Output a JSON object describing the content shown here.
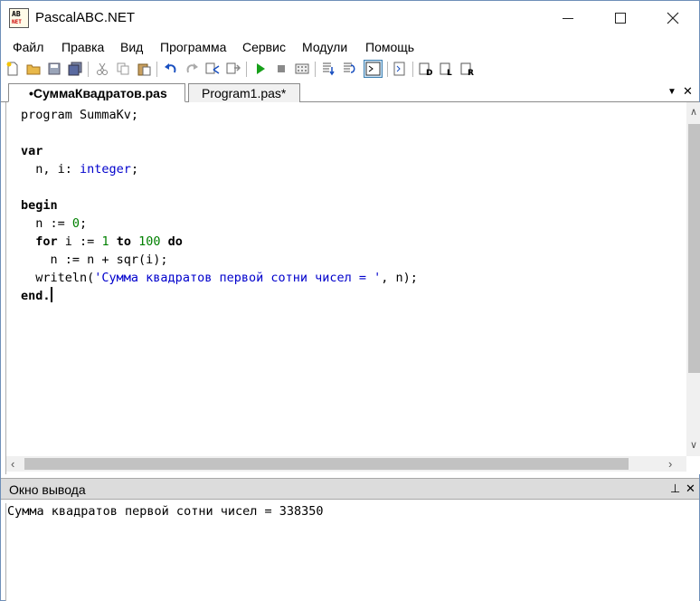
{
  "window": {
    "title": "PascalABC.NET"
  },
  "app_icon": {
    "line1": "AB",
    "line2": "NET"
  },
  "menu": [
    "Файл",
    "Правка",
    "Вид",
    "Программа",
    "Сервис",
    "Модули",
    "Помощь"
  ],
  "toolbar": {
    "icons": [
      "new-file-icon",
      "open-file-icon",
      "save-icon",
      "save-all-icon",
      "cut-icon",
      "copy-icon",
      "paste-icon",
      "undo-icon",
      "redo-icon",
      "find-icon",
      "replace-icon",
      "run-icon",
      "stop-icon",
      "compile-icon",
      "step-into-icon",
      "step-over-icon",
      "console-icon",
      "format-icon",
      "debug-d-icon",
      "debug-l-icon",
      "debug-r-icon"
    ]
  },
  "tabs": [
    {
      "label": "•СуммаКвадратов.pas",
      "active": true
    },
    {
      "label": "Program1.pas*",
      "active": false
    }
  ],
  "tab_controls": {
    "dropdown": "▼",
    "close": "✕"
  },
  "editor": {
    "lines": [
      [
        {
          "t": "program SummaKv;",
          "c": "plain"
        }
      ],
      [],
      [
        {
          "t": "var",
          "c": "kw"
        }
      ],
      [
        {
          "t": "  n, i: ",
          "c": "plain"
        },
        {
          "t": "integer",
          "c": "ty"
        },
        {
          "t": ";",
          "c": "plain"
        }
      ],
      [],
      [
        {
          "t": "begin",
          "c": "kw"
        }
      ],
      [
        {
          "t": "  n := ",
          "c": "plain"
        },
        {
          "t": "0",
          "c": "num"
        },
        {
          "t": ";",
          "c": "plain"
        }
      ],
      [
        {
          "t": "  ",
          "c": "plain"
        },
        {
          "t": "for",
          "c": "kw"
        },
        {
          "t": " i := ",
          "c": "plain"
        },
        {
          "t": "1",
          "c": "num"
        },
        {
          "t": " ",
          "c": "plain"
        },
        {
          "t": "to",
          "c": "kw"
        },
        {
          "t": " ",
          "c": "plain"
        },
        {
          "t": "100",
          "c": "num"
        },
        {
          "t": " ",
          "c": "plain"
        },
        {
          "t": "do",
          "c": "kw"
        }
      ],
      [
        {
          "t": "    n := n + sqr(i);",
          "c": "plain"
        }
      ],
      [
        {
          "t": "  writeln(",
          "c": "plain"
        },
        {
          "t": "'Сумма квадратов первой сотни чисел = '",
          "c": "str"
        },
        {
          "t": ", n);",
          "c": "plain"
        }
      ],
      [
        {
          "t": "end.",
          "c": "kw"
        }
      ]
    ],
    "caret_line": 10
  },
  "output": {
    "title": "Окно вывода",
    "pin": "⊥",
    "close": "✕",
    "text": "Сумма квадратов первой сотни чисел = 338350"
  },
  "colors": {
    "keyword": "#000000",
    "type": "#0000cc",
    "number": "#008000",
    "string": "#0000cc",
    "panel_header": "#dcdcdc"
  }
}
